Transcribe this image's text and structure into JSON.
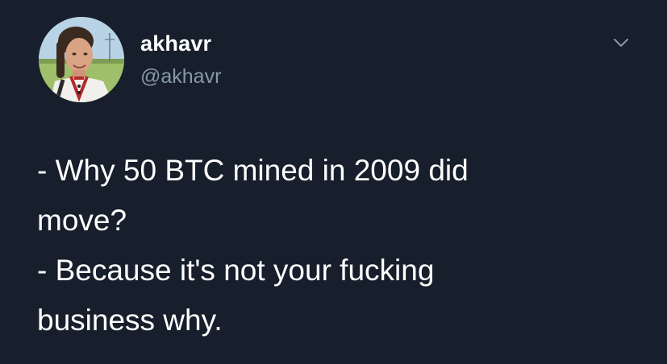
{
  "tweet": {
    "author": {
      "display_name": "akhavr",
      "handle": "@akhavr",
      "avatar_icon": "user-photo-avatar"
    },
    "menu_icon": "chevron-down-icon",
    "text_lines": [
      "- Why 50 BTC mined in 2009 did",
      "move?",
      "- Because it's not your fucking",
      "business why."
    ]
  },
  "colors": {
    "background": "#161f2b",
    "text_primary": "#ffffff",
    "text_secondary": "#8899a6"
  }
}
